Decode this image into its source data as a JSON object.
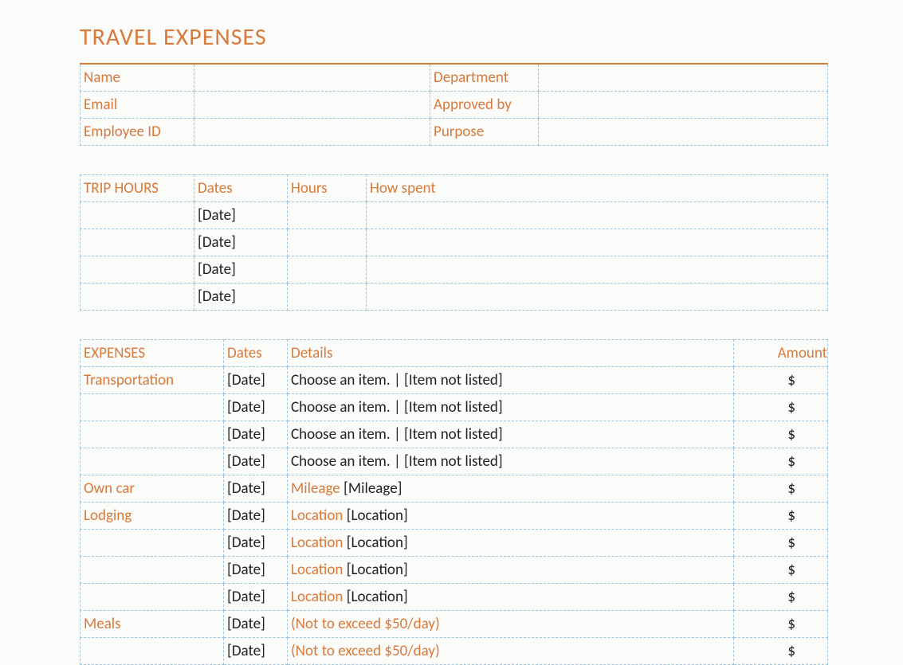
{
  "title": "TRAVEL EXPENSES",
  "info": {
    "labels": {
      "name": "Name",
      "department": "Department",
      "email": "Email",
      "approved": "Approved by",
      "employee": "Employee ID",
      "purpose": "Purpose"
    }
  },
  "trip": {
    "header": {
      "title": "TRIP HOURS",
      "dates": "Dates",
      "hours": "Hours",
      "how": "How spent"
    },
    "rows": [
      {
        "date": "[Date]"
      },
      {
        "date": "[Date]"
      },
      {
        "date": "[Date]"
      },
      {
        "date": "[Date]"
      }
    ]
  },
  "exp": {
    "header": {
      "title": "EXPENSES",
      "dates": "Dates",
      "details": "Details",
      "amount": "Amount"
    },
    "rows": [
      {
        "cat": "Transportation",
        "date": "[Date]",
        "detail_text": "Choose an item. | [Item not listed]",
        "amount": "$"
      },
      {
        "cat": "",
        "date": "[Date]",
        "detail_text": "Choose an item. | [Item not listed]",
        "amount": "$"
      },
      {
        "cat": "",
        "date": "[Date]",
        "detail_text": "Choose an item. | [Item not listed]",
        "amount": "$"
      },
      {
        "cat": "",
        "date": "[Date]",
        "detail_text": "Choose an item. | [Item not listed]",
        "amount": "$"
      },
      {
        "cat": "Own car",
        "date": "[Date]",
        "detail_label": "Mileage",
        "detail_val": " [Mileage]",
        "amount": "$"
      },
      {
        "cat": "Lodging",
        "date": "[Date]",
        "detail_label": "Location",
        "detail_val": " [Location]",
        "amount": "$"
      },
      {
        "cat": "",
        "date": "[Date]",
        "detail_label": "Location",
        "detail_val": " [Location]",
        "amount": "$"
      },
      {
        "cat": "",
        "date": "[Date]",
        "detail_label": "Location",
        "detail_val": " [Location]",
        "amount": "$"
      },
      {
        "cat": "",
        "date": "[Date]",
        "detail_label": "Location",
        "detail_val": " [Location]",
        "amount": "$"
      },
      {
        "cat": "Meals",
        "date": "[Date]",
        "detail_note": "(Not to exceed $50/day)",
        "amount": "$"
      },
      {
        "cat": "",
        "date": "[Date]",
        "detail_note": "(Not to exceed $50/day)",
        "amount": "$"
      }
    ]
  }
}
